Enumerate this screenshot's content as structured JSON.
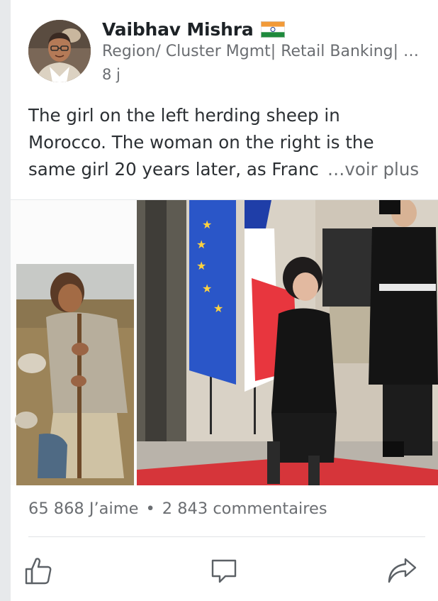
{
  "post": {
    "author": {
      "name": "Vaibhav Mishra",
      "headline": "Region/ Cluster Mgmt| Retail Banking| B…",
      "timestamp": "8 j"
    },
    "text_lines": [
      "The girl on the left herding sheep in",
      "Morocco. The woman on the right is the",
      "same girl 20 years later, as Franc"
    ],
    "see_more_label": "…voir plus",
    "social": {
      "likes": "65 868 J’aime",
      "separator": "•",
      "comments": "2 843 commentaires"
    },
    "actions": {
      "like_icon": "thumbs-up-icon",
      "comment_icon": "comment-icon",
      "share_icon": "share-icon"
    }
  },
  "colors": {
    "text_primary": "#1d2226",
    "text_secondary": "#6b6e72",
    "gutter": "#e7e9eb",
    "icon": "#5c6166"
  }
}
